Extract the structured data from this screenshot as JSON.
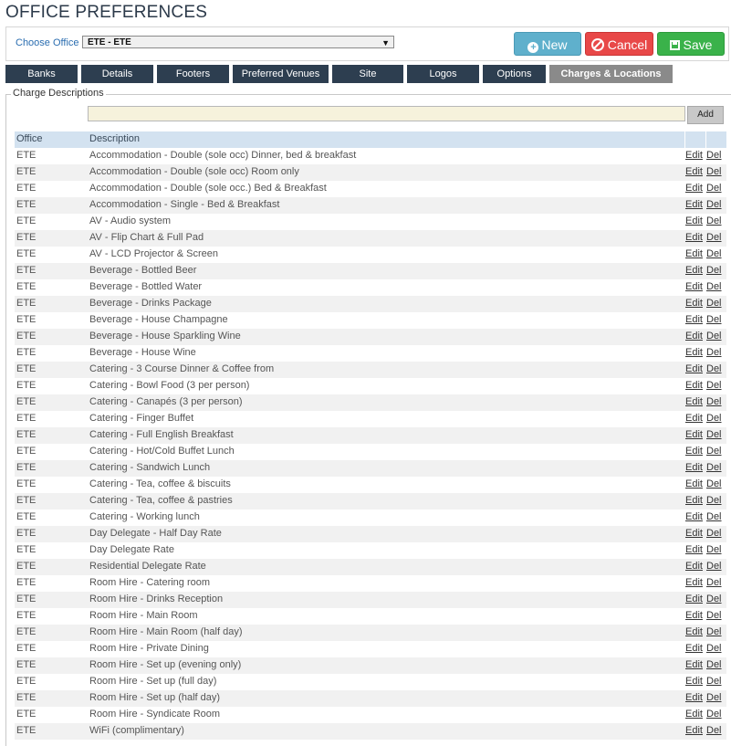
{
  "page_title": "OFFICE PREFERENCES",
  "office": {
    "label": "Choose Office",
    "selected": "ETE - ETE"
  },
  "buttons": {
    "new": "New",
    "cancel": "Cancel",
    "save": "Save"
  },
  "tabs": [
    {
      "label": "Banks",
      "active": false
    },
    {
      "label": "Details",
      "active": false
    },
    {
      "label": "Footers",
      "active": false
    },
    {
      "label": "Preferred Venues",
      "active": false
    },
    {
      "label": "Site",
      "active": false
    },
    {
      "label": "Logos",
      "active": false
    },
    {
      "label": "Options",
      "active": false
    },
    {
      "label": "Charges & Locations",
      "active": true
    }
  ],
  "charges": {
    "legend": "Charge Descriptions",
    "add_value": "",
    "add_label": "Add",
    "columns": {
      "office": "Office",
      "description": "Description"
    },
    "edit_label": "Edit",
    "del_label": "Del",
    "rows": [
      {
        "office": "ETE",
        "description": "Accommodation - Double (sole occ) Dinner, bed & breakfast"
      },
      {
        "office": "ETE",
        "description": "Accommodation - Double (sole occ) Room only"
      },
      {
        "office": "ETE",
        "description": "Accommodation - Double (sole occ.) Bed & Breakfast"
      },
      {
        "office": "ETE",
        "description": "Accommodation - Single - Bed & Breakfast"
      },
      {
        "office": "ETE",
        "description": "AV - Audio system"
      },
      {
        "office": "ETE",
        "description": "AV - Flip Chart & Full Pad"
      },
      {
        "office": "ETE",
        "description": "AV - LCD Projector & Screen"
      },
      {
        "office": "ETE",
        "description": "Beverage - Bottled Beer"
      },
      {
        "office": "ETE",
        "description": "Beverage - Bottled Water"
      },
      {
        "office": "ETE",
        "description": "Beverage - Drinks Package"
      },
      {
        "office": "ETE",
        "description": "Beverage - House Champagne"
      },
      {
        "office": "ETE",
        "description": "Beverage - House Sparkling Wine"
      },
      {
        "office": "ETE",
        "description": "Beverage - House Wine"
      },
      {
        "office": "ETE",
        "description": "Catering - 3 Course Dinner & Coffee from"
      },
      {
        "office": "ETE",
        "description": "Catering - Bowl Food (3 per person)"
      },
      {
        "office": "ETE",
        "description": "Catering - Canapés (3 per person)"
      },
      {
        "office": "ETE",
        "description": "Catering - Finger Buffet"
      },
      {
        "office": "ETE",
        "description": "Catering - Full English Breakfast"
      },
      {
        "office": "ETE",
        "description": "Catering - Hot/Cold Buffet Lunch"
      },
      {
        "office": "ETE",
        "description": "Catering - Sandwich Lunch"
      },
      {
        "office": "ETE",
        "description": "Catering - Tea, coffee & biscuits"
      },
      {
        "office": "ETE",
        "description": "Catering - Tea, coffee & pastries"
      },
      {
        "office": "ETE",
        "description": "Catering - Working lunch"
      },
      {
        "office": "ETE",
        "description": "Day Delegate - Half Day Rate"
      },
      {
        "office": "ETE",
        "description": "Day Delegate Rate"
      },
      {
        "office": "ETE",
        "description": "Residential Delegate Rate"
      },
      {
        "office": "ETE",
        "description": "Room Hire - Catering room"
      },
      {
        "office": "ETE",
        "description": "Room Hire - Drinks Reception"
      },
      {
        "office": "ETE",
        "description": "Room Hire - Main Room"
      },
      {
        "office": "ETE",
        "description": "Room Hire - Main Room (half day)"
      },
      {
        "office": "ETE",
        "description": "Room Hire - Private Dining"
      },
      {
        "office": "ETE",
        "description": "Room Hire - Set up (evening only)"
      },
      {
        "office": "ETE",
        "description": "Room Hire - Set up (full day)"
      },
      {
        "office": "ETE",
        "description": "Room Hire - Set up (half day)"
      },
      {
        "office": "ETE",
        "description": "Room Hire - Syndicate Room"
      },
      {
        "office": "ETE",
        "description": "WiFi (complimentary)"
      }
    ]
  }
}
